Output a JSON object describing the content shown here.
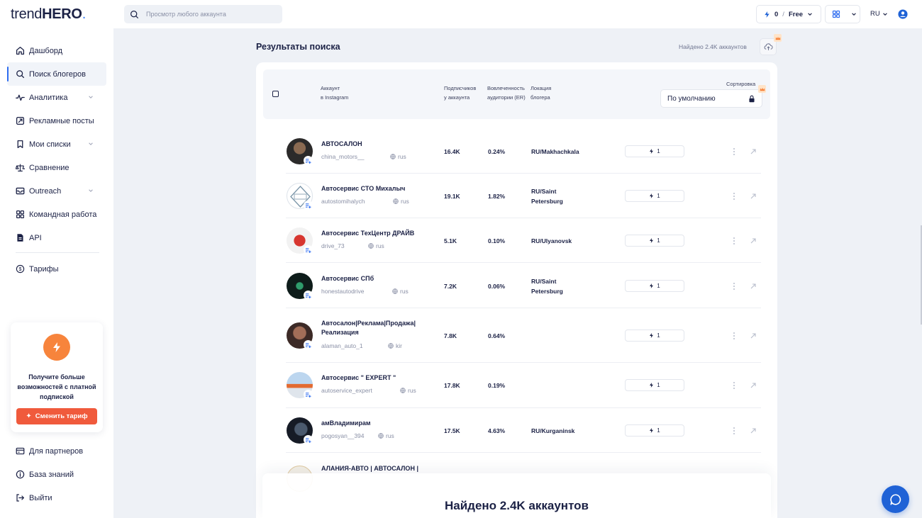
{
  "app": {
    "logo_text": "trendHERO",
    "logo_regular": "trend",
    "logo_bold": "HERO",
    "logo_dot": "."
  },
  "sidebar": {
    "items": [
      {
        "label": "Дашборд",
        "icon": "home-icon"
      },
      {
        "label": "Поиск блогеров",
        "icon": "search-icon",
        "active": true
      },
      {
        "label": "Аналитика",
        "icon": "analytics-icon",
        "expandable": true
      },
      {
        "label": "Рекламные посты",
        "icon": "ad-post-icon"
      },
      {
        "label": "Мои списки",
        "icon": "bookmark-icon",
        "expandable": true
      },
      {
        "label": "Сравнение",
        "icon": "scales-icon"
      },
      {
        "label": "Outreach",
        "icon": "outreach-icon",
        "expandable": true
      },
      {
        "label": "Командная работа",
        "icon": "team-grid-icon"
      },
      {
        "label": "API",
        "icon": "document-icon"
      }
    ],
    "tariffs": {
      "label": "Тарифы",
      "icon": "dollar-icon"
    },
    "promo": {
      "text": "Получите больше возможностей с платной подпиской",
      "button": "Сменить тариф"
    },
    "bottom": [
      {
        "label": "Для партнеров",
        "icon": "card-icon"
      },
      {
        "label": "База знаний",
        "icon": "info-icon"
      },
      {
        "label": "Выйти",
        "icon": "logout-icon"
      }
    ]
  },
  "header": {
    "search_placeholder": "Просмотр любого аккаунта",
    "credits": "0",
    "separator": "/",
    "plan": "Free",
    "language": "RU"
  },
  "main": {
    "title": "Результаты поиска",
    "found_small": "Найдено 2.4K аккаунтов",
    "found_large": "Найдено 2.4K аккаунтов",
    "columns": {
      "account": [
        "Аккаунт",
        "в Instagram"
      ],
      "followers": [
        "Подписчиков",
        "у аккаунта"
      ],
      "er": [
        "Вовлеченность",
        "аудитории (ER)"
      ],
      "location": [
        "Локация",
        "блогера"
      ],
      "sort_label": "Сортировка",
      "sort_value": "По умолчанию"
    },
    "rows": [
      {
        "name": "АВТОСАЛОН",
        "username": "china_motors__",
        "lang": "rus",
        "followers": "16.4K",
        "er": "0.24%",
        "location": [
          "RU/Makhachkala"
        ],
        "credits": "1"
      },
      {
        "name": "Автосервис СТО Михалыч",
        "username": "autostomihalych",
        "lang": "rus",
        "followers": "19.1K",
        "er": "1.82%",
        "location": [
          "RU/Saint",
          "Petersburg"
        ],
        "credits": "1"
      },
      {
        "name": "Автосервис ТехЦентр ДРАЙВ",
        "username": "drive_73",
        "lang": "rus",
        "followers": "5.1K",
        "er": "0.10%",
        "location": [
          "RU/Ulyanovsk"
        ],
        "credits": "1"
      },
      {
        "name": "Автосервис СПб",
        "username": "honestautodrive",
        "lang": "rus",
        "followers": "7.2K",
        "er": "0.06%",
        "location": [
          "RU/Saint",
          "Petersburg"
        ],
        "credits": "1"
      },
      {
        "name": [
          "Автосалон|Реклама|Продажа|",
          "Реализация"
        ],
        "username": "alaman_auto_1",
        "lang": "kir",
        "followers": "7.8K",
        "er": "0.64%",
        "location": [],
        "credits": "1"
      },
      {
        "name": "Автосервис \" EXPERT \"",
        "username": "autoservice_expert",
        "lang": "rus",
        "followers": "17.8K",
        "er": "0.19%",
        "location": [],
        "credits": "1"
      },
      {
        "name": "амВладимирам",
        "username": "pogosyan__394",
        "lang": "rus",
        "followers": "17.5K",
        "er": "4.63%",
        "location": [
          "RU/Kurganinsk"
        ],
        "credits": "1"
      },
      {
        "name": "АЛАНИЯ-АВТО | АВТОСАЛОН |"
      }
    ]
  },
  "colors": {
    "accent": "#2f6df0",
    "promo_orange": "#f7843c",
    "promo_button": "#f05a3c",
    "text_dark": "#1b2145",
    "chat": "#1f62d6"
  }
}
